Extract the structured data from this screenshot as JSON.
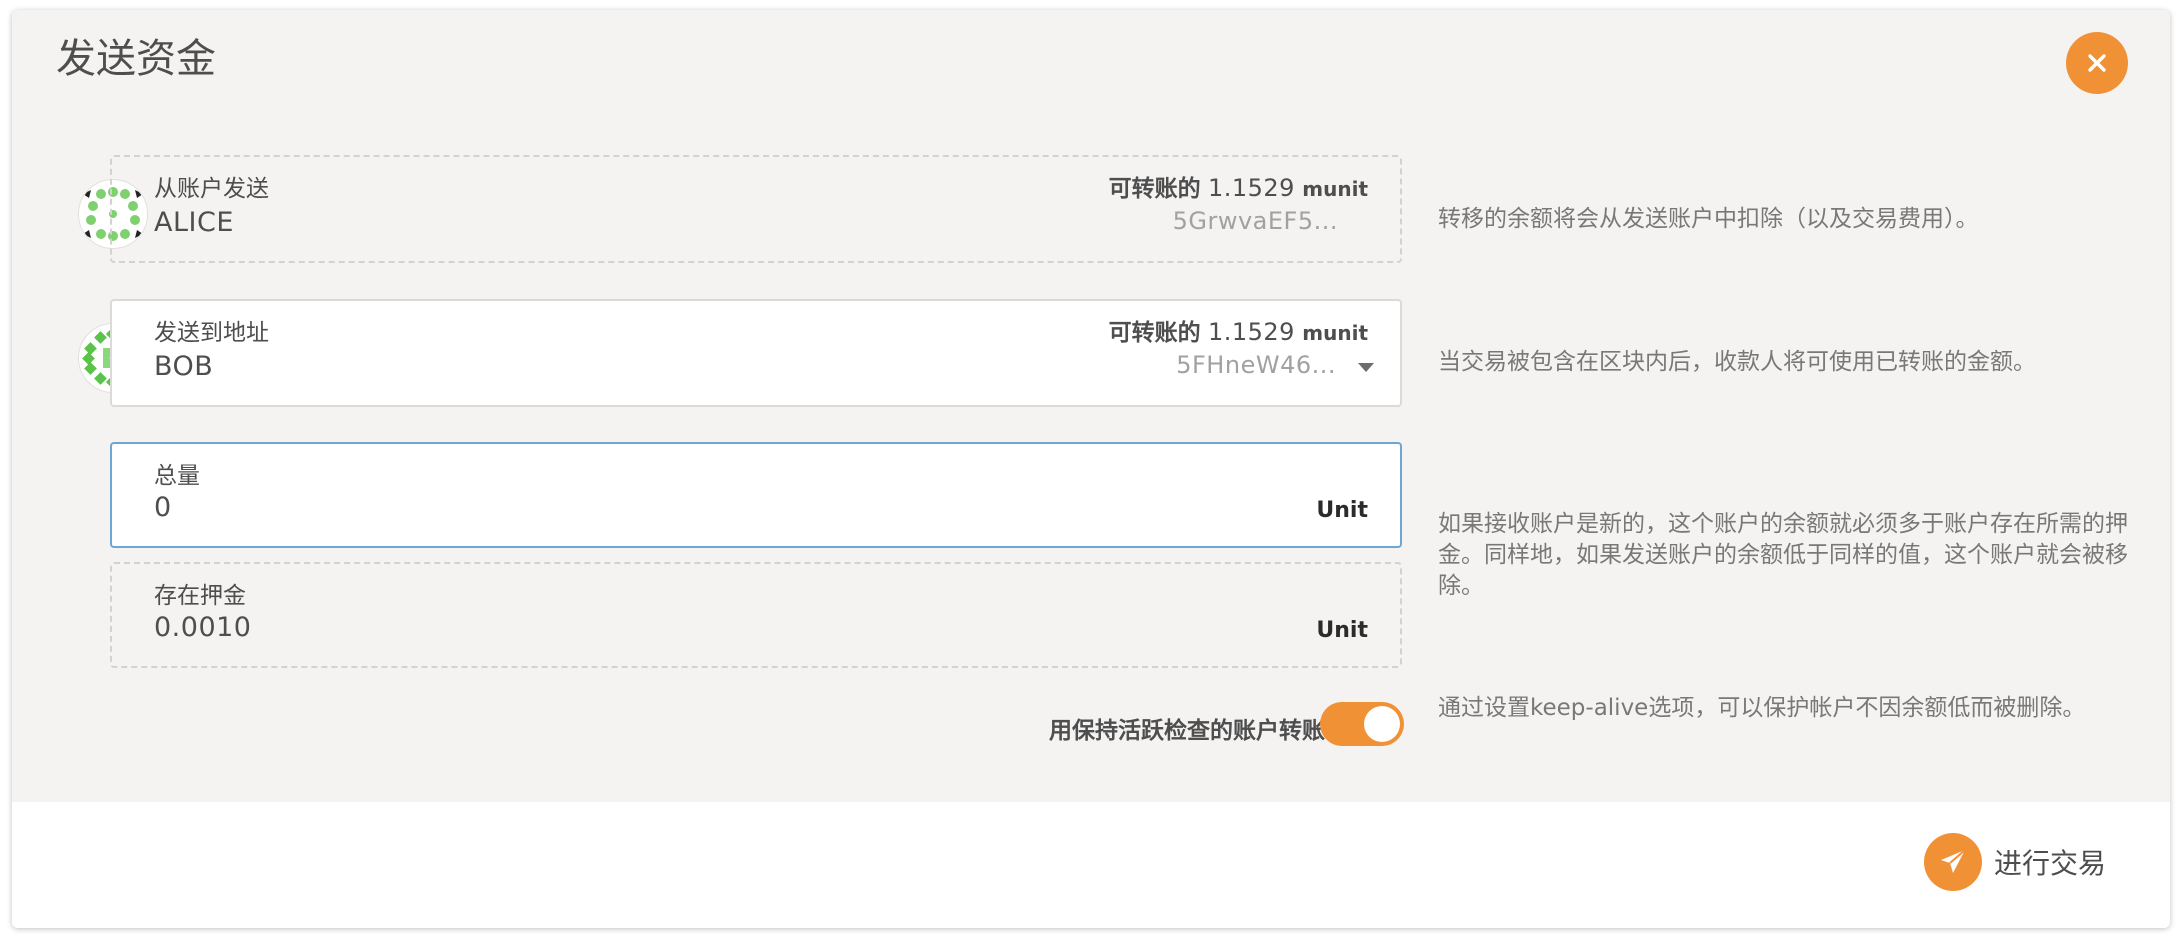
{
  "modal": {
    "title": "发送资金",
    "close_icon": "close-icon",
    "accent_color": "#f19135"
  },
  "from": {
    "label": "从账户发送",
    "account_name": "ALICE",
    "transferable_label": "可转账的",
    "transferable_value": "1.1529",
    "transferable_unit": "munit",
    "address": "5GrwvaEF5...",
    "help": "转移的余额将会从发送账户中扣除（以及交易费用）。"
  },
  "to": {
    "label": "发送到地址",
    "account_name": "BOB",
    "transferable_label": "可转账的",
    "transferable_value": "1.1529",
    "transferable_unit": "munit",
    "address": "5FHneW46...",
    "dropdown_icon": "chevron-down-icon",
    "help": "当交易被包含在区块内后，收款人将可使用已转账的金额。"
  },
  "amount": {
    "label": "总量",
    "value": "0",
    "unit": "Unit"
  },
  "deposit": {
    "label": "存在押金",
    "value": "0.0010",
    "unit": "Unit",
    "help": "如果接收账户是新的，这个账户的余额就必须多于账户存在所需的押金。同样地，如果发送账户的余额低于同样的值，这个账户就会被移除。"
  },
  "keep_alive": {
    "label": "用保持活跃检查的账户转账",
    "enabled": true,
    "help": "通过设置keep-alive选项，可以保护帐户不因余额低而被删除。"
  },
  "footer": {
    "submit_label": "进行交易",
    "submit_icon": "paper-plane-icon"
  }
}
